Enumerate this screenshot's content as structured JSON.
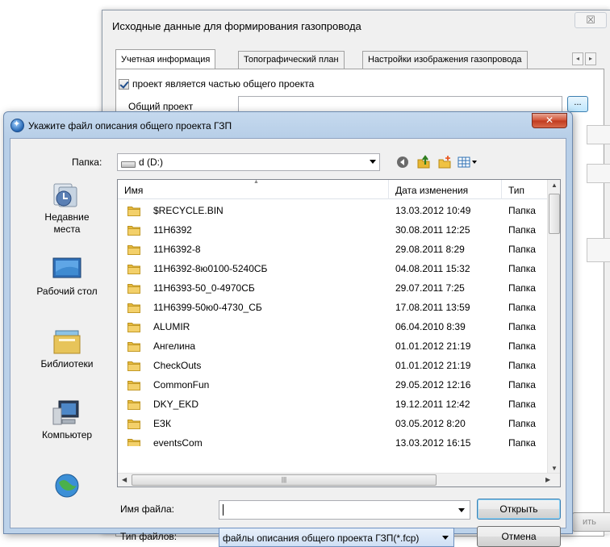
{
  "background_dialog": {
    "title": "Исходные данные для формирования газопровода",
    "close_glyph": "☒",
    "tabs": [
      "Учетная информация",
      "Топографический план",
      "Настройки изображения  газопровода"
    ],
    "tab_scroll_left": "◂",
    "tab_scroll_right": "▸",
    "checkbox_label": "проект является частью общего проекта",
    "checkbox_checked": true,
    "common_project_label": "Общий проект",
    "common_project_value": "",
    "browse_label": "...",
    "footer_button_partial": "ить"
  },
  "file_dialog": {
    "title": "Укажите файл  описания общего проекта ГЗП",
    "close_glyph": "✕",
    "look_in_label": "Папка:",
    "look_in_value": "d (D:)",
    "toolbar_icons": [
      "back-icon",
      "up-folder-icon",
      "new-folder-icon",
      "view-menu-icon"
    ],
    "places": [
      {
        "label": "Недавние места",
        "icon": "recent-places-icon"
      },
      {
        "label": "Рабочий стол",
        "icon": "desktop-icon"
      },
      {
        "label": "Библиотеки",
        "icon": "libraries-icon"
      },
      {
        "label": "Компьютер",
        "icon": "computer-icon"
      },
      {
        "label": "",
        "icon": "network-icon"
      }
    ],
    "columns": {
      "name": "Имя",
      "date": "Дата изменения",
      "type": "Тип"
    },
    "files": [
      {
        "name": "$RECYCLE.BIN",
        "date": "13.03.2012 10:49",
        "type": "Папка"
      },
      {
        "name": "11H6392",
        "date": "30.08.2011 12:25",
        "type": "Папка"
      },
      {
        "name": "11H6392-8",
        "date": "29.08.2011 8:29",
        "type": "Папка"
      },
      {
        "name": "11H6392-8ю0100-5240СБ",
        "date": "04.08.2011 15:32",
        "type": "Папка"
      },
      {
        "name": "11H6393-50_0-4970СБ",
        "date": "29.07.2011 7:25",
        "type": "Папка"
      },
      {
        "name": "11H6399-50ю0-4730_СБ",
        "date": "17.08.2011 13:59",
        "type": "Папка"
      },
      {
        "name": "ALUMIR",
        "date": "06.04.2010 8:39",
        "type": "Папка"
      },
      {
        "name": "Ангелина",
        "date": "01.01.2012 21:19",
        "type": "Папка"
      },
      {
        "name": "CheckOuts",
        "date": "01.01.2012 21:19",
        "type": "Папка"
      },
      {
        "name": "CommonFun",
        "date": "29.05.2012 12:16",
        "type": "Папка"
      },
      {
        "name": "DKY_EKD",
        "date": "19.12.2011 12:42",
        "type": "Папка"
      },
      {
        "name": "ЕЗК",
        "date": "03.05.2012 8:20",
        "type": "Папка"
      },
      {
        "name": "eventsCom",
        "date": "13.03.2012 16:15",
        "type": "Папка"
      }
    ],
    "file_name_label": "Имя файла:",
    "file_name_value": "",
    "file_type_label": "Тип файлов:",
    "file_type_value": "файлы описания общего проекта ГЗП(*.fcp)",
    "open_button": "Открыть",
    "cancel_button": "Отмена"
  }
}
